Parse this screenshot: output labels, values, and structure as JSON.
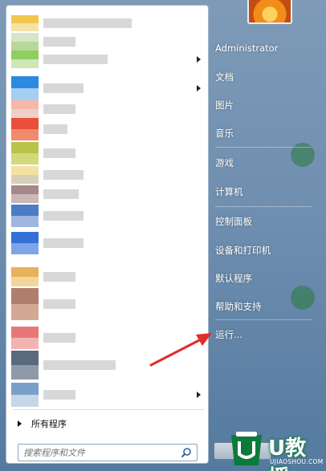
{
  "start_menu": {
    "programs": [
      {
        "colors": [
          "#f0c64c",
          "#f5e2a8"
        ],
        "has_submenu": false
      },
      {
        "colors": [
          "#d6e6c4",
          "#b7d89a"
        ],
        "has_submenu": false
      },
      {
        "colors": [
          "#8fcf5e",
          "#cfe6b6"
        ],
        "has_submenu": true
      },
      {
        "colors": [
          "#2b8be0",
          "#a4cef2"
        ],
        "has_submenu": true
      },
      {
        "colors": [
          "#f6b7a8",
          "#f0d0c6"
        ],
        "has_submenu": false
      },
      {
        "colors": [
          "#e94f3b",
          "#f08a6f"
        ],
        "has_submenu": false
      },
      {
        "colors": [
          "#b9c34a",
          "#d2d97a"
        ],
        "has_submenu": false
      },
      {
        "colors": [
          "#f2e1a0",
          "#d9cfb7"
        ],
        "has_submenu": false
      },
      {
        "colors": [
          "#a6878a",
          "#cab7b8"
        ],
        "has_submenu": false
      },
      {
        "colors": [
          "#4a7cc8",
          "#9fb6de"
        ],
        "has_submenu": false
      },
      {
        "colors": [
          "#3470d8",
          "#7ea5e6"
        ],
        "has_submenu": false
      },
      {
        "colors": [
          "#e8b15a",
          "#f2d59a"
        ],
        "has_submenu": false
      },
      {
        "colors": [
          "#b07e6d",
          "#d4a994"
        ],
        "has_submenu": false
      },
      {
        "colors": [
          "#e87878",
          "#f2b3b3"
        ],
        "has_submenu": false
      },
      {
        "colors": [
          "#5a6a7e",
          "#8e9aaa"
        ],
        "has_submenu": false
      },
      {
        "colors": [
          "#7aa0c8",
          "#c6d6e8"
        ],
        "has_submenu": true
      }
    ],
    "all_programs": "所有程序",
    "search_placeholder": "搜索程序和文件",
    "right_items": [
      {
        "label": "Administrator",
        "name": "administrator"
      },
      {
        "label": "文档",
        "name": "documents"
      },
      {
        "label": "图片",
        "name": "pictures"
      },
      {
        "label": "音乐",
        "name": "music"
      },
      {
        "label": "游戏",
        "name": "games"
      },
      {
        "label": "计算机",
        "name": "computer"
      },
      {
        "label": "控制面板",
        "name": "control-panel"
      },
      {
        "label": "设备和打印机",
        "name": "devices-and-printers"
      },
      {
        "label": "默认程序",
        "name": "default-programs"
      },
      {
        "label": "帮助和支持",
        "name": "help-and-support"
      },
      {
        "label": "运行...",
        "name": "run"
      }
    ]
  },
  "watermark": {
    "text": "U教授",
    "sub": "UJIAOSHOU.COM"
  },
  "colors": {
    "arrow": "#e32b2b",
    "watermark_green": "#0c7a3a"
  }
}
